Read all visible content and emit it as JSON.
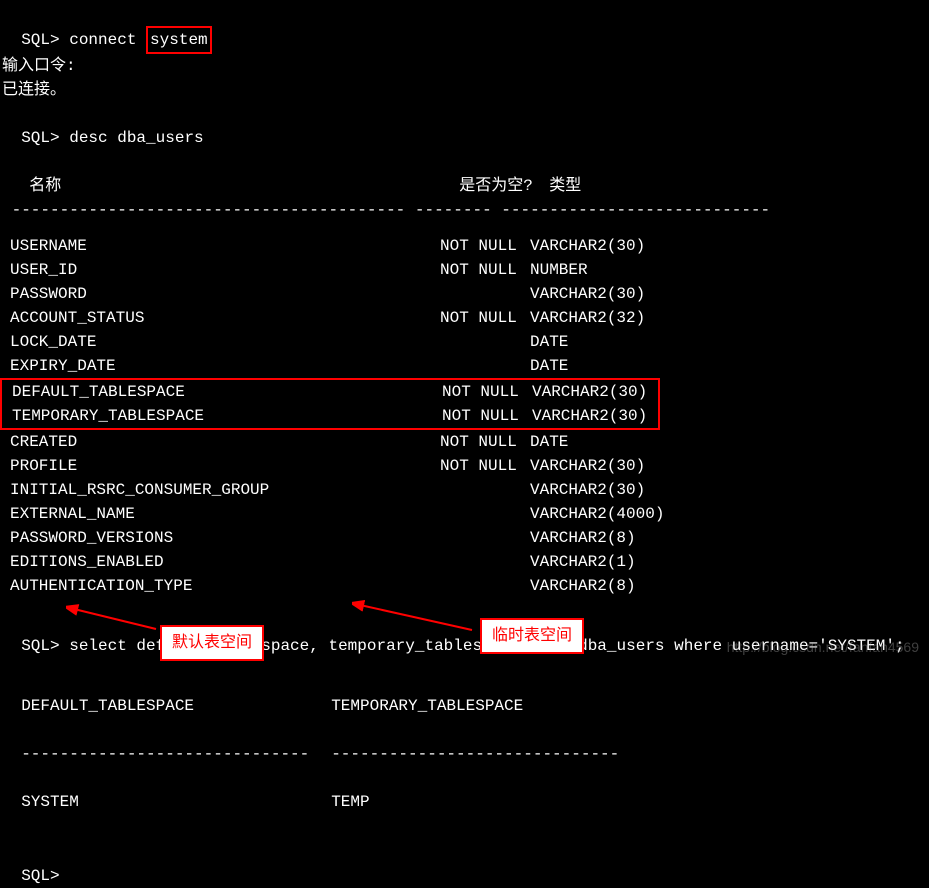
{
  "prompt": "SQL>",
  "cmd1_prefix": "connect ",
  "cmd1_boxed": "system",
  "line2": "输入口令:",
  "line3": "已连接。",
  "cmd2": "desc dba_users",
  "header_name": "名称",
  "header_null": "是否为空?",
  "header_type": "类型",
  "dashes1": " ----------------------------------------- -------- ----------------------------",
  "cols": [
    {
      "name": "USERNAME",
      "null": "NOT NULL",
      "type": "VARCHAR2(30)"
    },
    {
      "name": "USER_ID",
      "null": "NOT NULL",
      "type": "NUMBER"
    },
    {
      "name": "PASSWORD",
      "null": "",
      "type": "VARCHAR2(30)"
    },
    {
      "name": "ACCOUNT_STATUS",
      "null": "NOT NULL",
      "type": "VARCHAR2(32)"
    },
    {
      "name": "LOCK_DATE",
      "null": "",
      "type": "DATE"
    },
    {
      "name": "EXPIRY_DATE",
      "null": "",
      "type": "DATE"
    }
  ],
  "cols_boxed": [
    {
      "name": "DEFAULT_TABLESPACE",
      "null": "NOT NULL",
      "type": "VARCHAR2(30)"
    },
    {
      "name": "TEMPORARY_TABLESPACE",
      "null": "NOT NULL",
      "type": "VARCHAR2(30)"
    }
  ],
  "cols2": [
    {
      "name": "CREATED",
      "null": "NOT NULL",
      "type": "DATE"
    },
    {
      "name": "PROFILE",
      "null": "NOT NULL",
      "type": "VARCHAR2(30)"
    },
    {
      "name": "INITIAL_RSRC_CONSUMER_GROUP",
      "null": "",
      "type": "VARCHAR2(30)"
    },
    {
      "name": "EXTERNAL_NAME",
      "null": "",
      "type": "VARCHAR2(4000)"
    },
    {
      "name": "PASSWORD_VERSIONS",
      "null": "",
      "type": "VARCHAR2(8)"
    },
    {
      "name": "EDITIONS_ENABLED",
      "null": "",
      "type": "VARCHAR2(1)"
    },
    {
      "name": "AUTHENTICATION_TYPE",
      "null": "",
      "type": "VARCHAR2(8)"
    }
  ],
  "cmd3": "select default_tablespace, temporary_tablespace from dba_users where username='SYSTEM';",
  "result_header1": "DEFAULT_TABLESPACE",
  "result_header2": "TEMPORARY_TABLESPACE",
  "result_dash1": "------------------------------",
  "result_dash2": "------------------------------",
  "result_val1": "SYSTEM",
  "result_val2": "TEMP",
  "annotation1": "默认表空间",
  "annotation2": "临时表空间",
  "watermark": "http://blog.csdn.net/fanfan4569"
}
